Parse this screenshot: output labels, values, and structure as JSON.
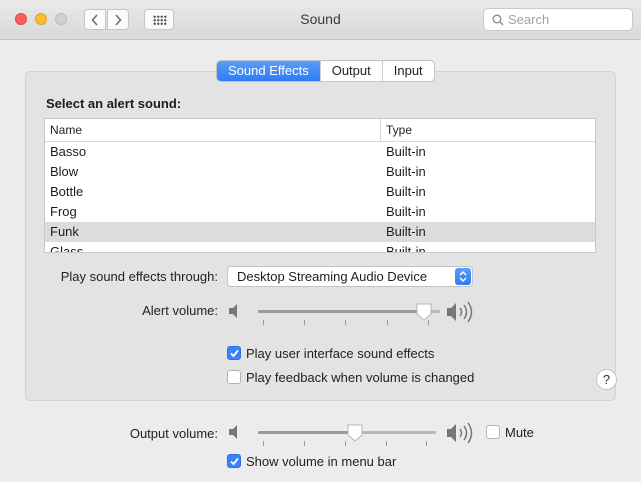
{
  "window": {
    "title": "Sound"
  },
  "toolbar": {
    "back_icon": "chevron-left-icon",
    "forward_icon": "chevron-right-icon",
    "grid_icon": "grid-icon"
  },
  "search": {
    "placeholder": "Search",
    "value": ""
  },
  "tabs": [
    {
      "label": "Sound Effects",
      "active": true
    },
    {
      "label": "Output",
      "active": false
    },
    {
      "label": "Input",
      "active": false
    }
  ],
  "alert": {
    "title": "Select an alert sound:",
    "columns": [
      "Name",
      "Type"
    ],
    "rows": [
      {
        "name": "Basso",
        "type": "Built-in"
      },
      {
        "name": "Blow",
        "type": "Built-in"
      },
      {
        "name": "Bottle",
        "type": "Built-in"
      },
      {
        "name": "Frog",
        "type": "Built-in"
      },
      {
        "name": "Funk",
        "type": "Built-in",
        "selected": true
      },
      {
        "name": "Glass",
        "type": "Built-in"
      }
    ]
  },
  "play_through": {
    "label": "Play sound effects through:",
    "value": "Desktop Streaming Audio Device"
  },
  "alert_volume": {
    "label": "Alert volume:",
    "level": 0.95
  },
  "checkboxes": {
    "ui_effects": {
      "label": "Play user interface sound effects",
      "checked": true
    },
    "feedback": {
      "label": "Play feedback when volume is changed",
      "checked": false
    }
  },
  "help": {
    "label": "?"
  },
  "output_volume": {
    "label": "Output volume:",
    "level": 0.55,
    "mute_label": "Mute",
    "mute": false
  },
  "menu_bar": {
    "label": "Show volume in menu bar",
    "checked": true
  },
  "colors": {
    "accent": "#2e7cf6",
    "selection": "#dcdcdc"
  }
}
